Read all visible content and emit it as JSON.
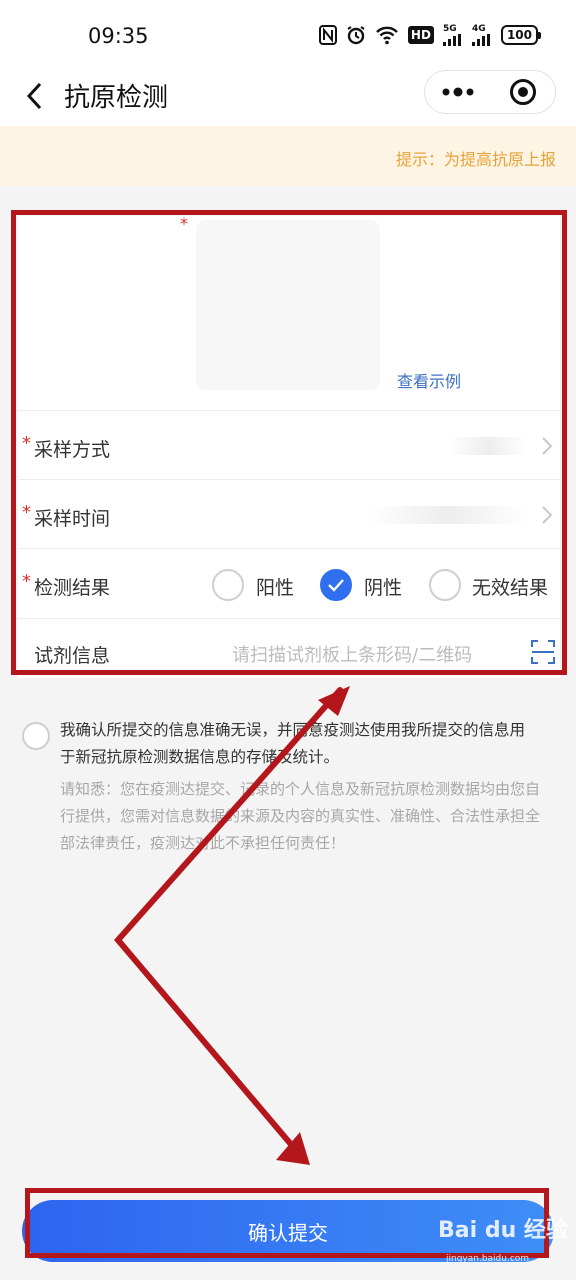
{
  "status_bar": {
    "time": "09:35",
    "hd_label": "HD",
    "net1": "5G",
    "net2": "4G",
    "battery": "100"
  },
  "nav": {
    "title": "抗原检测",
    "back_icon": "chevron-left-icon",
    "menu_icon": "more-dots-icon",
    "close_icon": "target-circle-icon"
  },
  "tip": {
    "text": "提示：为提高抗原上报"
  },
  "photo": {
    "required_mark": "*",
    "view_example": "查看示例"
  },
  "form": {
    "sampling_method": {
      "required_mark": "*",
      "label": "采样方式"
    },
    "sampling_time": {
      "required_mark": "*",
      "label": "采样时间"
    },
    "test_result": {
      "required_mark": "*",
      "label": "检测结果",
      "options": [
        "阳性",
        "阴性",
        "无效结果"
      ],
      "selected": "阴性"
    },
    "reagent": {
      "label": "试剂信息",
      "placeholder": "请扫描试剂板上条形码/二维码"
    }
  },
  "agreement": {
    "text": "我确认所提交的信息准确无误，并同意疫测达使用我所提交的信息用于新冠抗原检测数据信息的存储及统计。",
    "notice": "请知悉：您在疫测达提交、记录的个人信息及新冠抗原检测数据均由您自行提供，您需对信息数据的来源及内容的真实性、准确性、合法性承担全部法律责任，疫测达对此不承担任何责任！",
    "checked": false
  },
  "submit": {
    "label": "确认提交"
  },
  "watermark": {
    "text": "Bai du 经验",
    "sub": "jingyan.baidu.com"
  },
  "colors": {
    "accent": "#2f6ff0",
    "required": "#d9322c",
    "tip_bg": "#fdf4e4",
    "tip_text": "#e8a23a",
    "annotation": "#b3171c"
  }
}
